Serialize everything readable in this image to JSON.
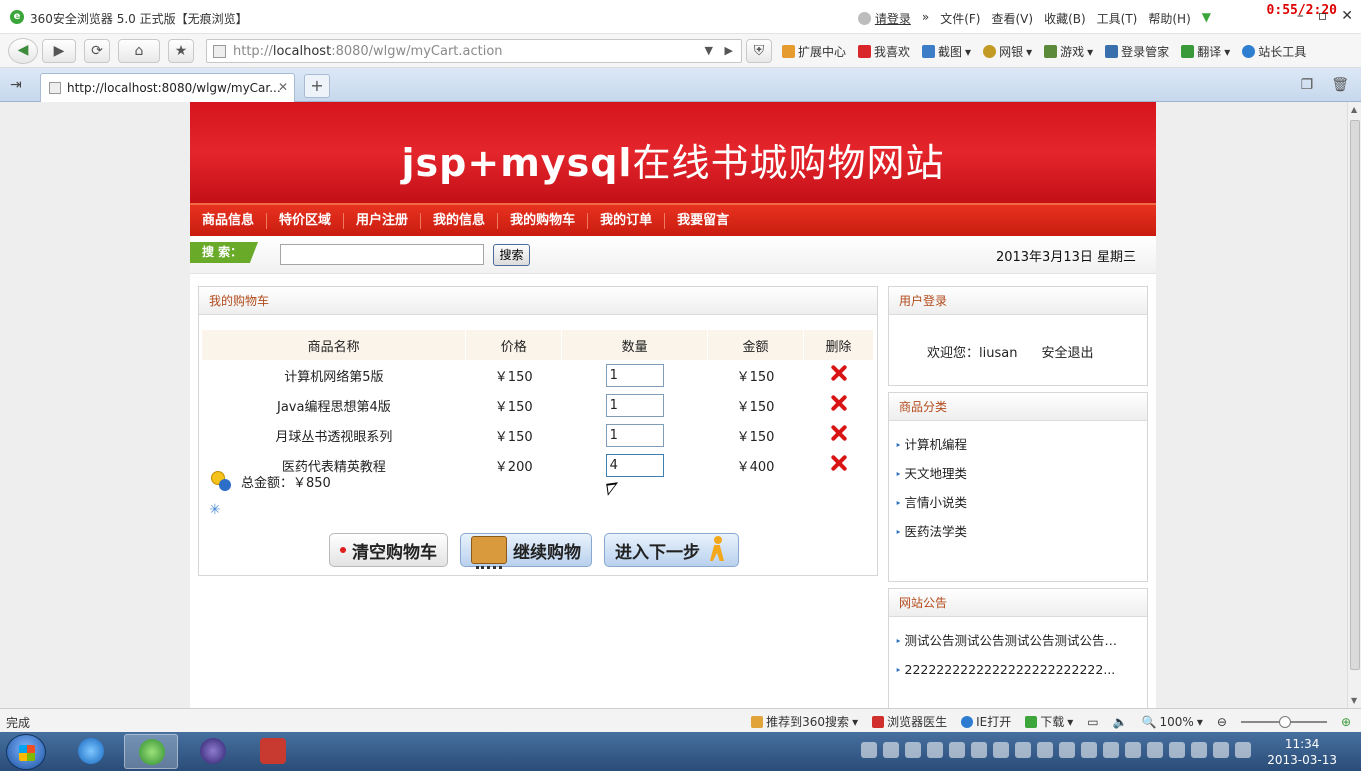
{
  "browser": {
    "title": "360安全浏览器 5.0 正式版【无痕浏览】",
    "login_link": "请登录",
    "menu": [
      "文件(F)",
      "查看(V)",
      "收藏(B)",
      "工具(T)",
      "帮助(H)"
    ],
    "timer": "0:55/2:20",
    "url_prefix": "http://",
    "url_host": "localhost",
    "url_rest": ":8080/wlgw/myCart.action",
    "toolbar": [
      "扩展中心",
      "我喜欢",
      "截图",
      "网银",
      "游戏",
      "登录管家",
      "翻译",
      "站长工具"
    ],
    "tab_title": "http://localhost:8080/wlgw/myCar...",
    "status_text": "完成",
    "status_items": [
      "推荐到360搜索",
      "浏览器医生",
      "IE打开",
      "下载"
    ],
    "zoom": "100%",
    "clock_time": "11:34",
    "clock_date": "2013-03-13"
  },
  "site": {
    "banner_latin": "jsp+mysql",
    "banner_cn": "在线书城购物网站",
    "nav": [
      "商品信息",
      "特价区域",
      "用户注册",
      "我的信息",
      "我的购物车",
      "我的订单",
      "我要留言"
    ],
    "search_label": "搜 索：",
    "search_button": "搜索",
    "date": "2013年3月13日  星期三"
  },
  "cart": {
    "title": "我的购物车",
    "headers": [
      "商品名称",
      "价格",
      "数量",
      "金额",
      "删除"
    ],
    "rows": [
      {
        "name": "计算机网络第5版",
        "price": "￥150",
        "qty": "1",
        "amount": "￥150"
      },
      {
        "name": "Java编程思想第4版",
        "price": "￥150",
        "qty": "1",
        "amount": "￥150"
      },
      {
        "name": "月球丛书透视眼系列",
        "price": "￥150",
        "qty": "1",
        "amount": "￥150"
      },
      {
        "name": "医药代表精英教程",
        "price": "￥200",
        "qty": "4",
        "amount": "￥400"
      }
    ],
    "total_label": "总金额：￥850",
    "btn_clear": "清空购物车",
    "btn_continue": "继续购物",
    "btn_next": "进入下一步"
  },
  "sidebar": {
    "login_title": "用户登录",
    "welcome": "欢迎您：liusan",
    "logout": "安全退出",
    "category_title": "商品分类",
    "categories": [
      "计算机编程",
      "天文地理类",
      "言情小说类",
      "医药法学类"
    ],
    "notice_title": "网站公告",
    "notices": [
      "测试公告测试公告测试公告测试公告…",
      "2222222222222222222222222..."
    ]
  }
}
